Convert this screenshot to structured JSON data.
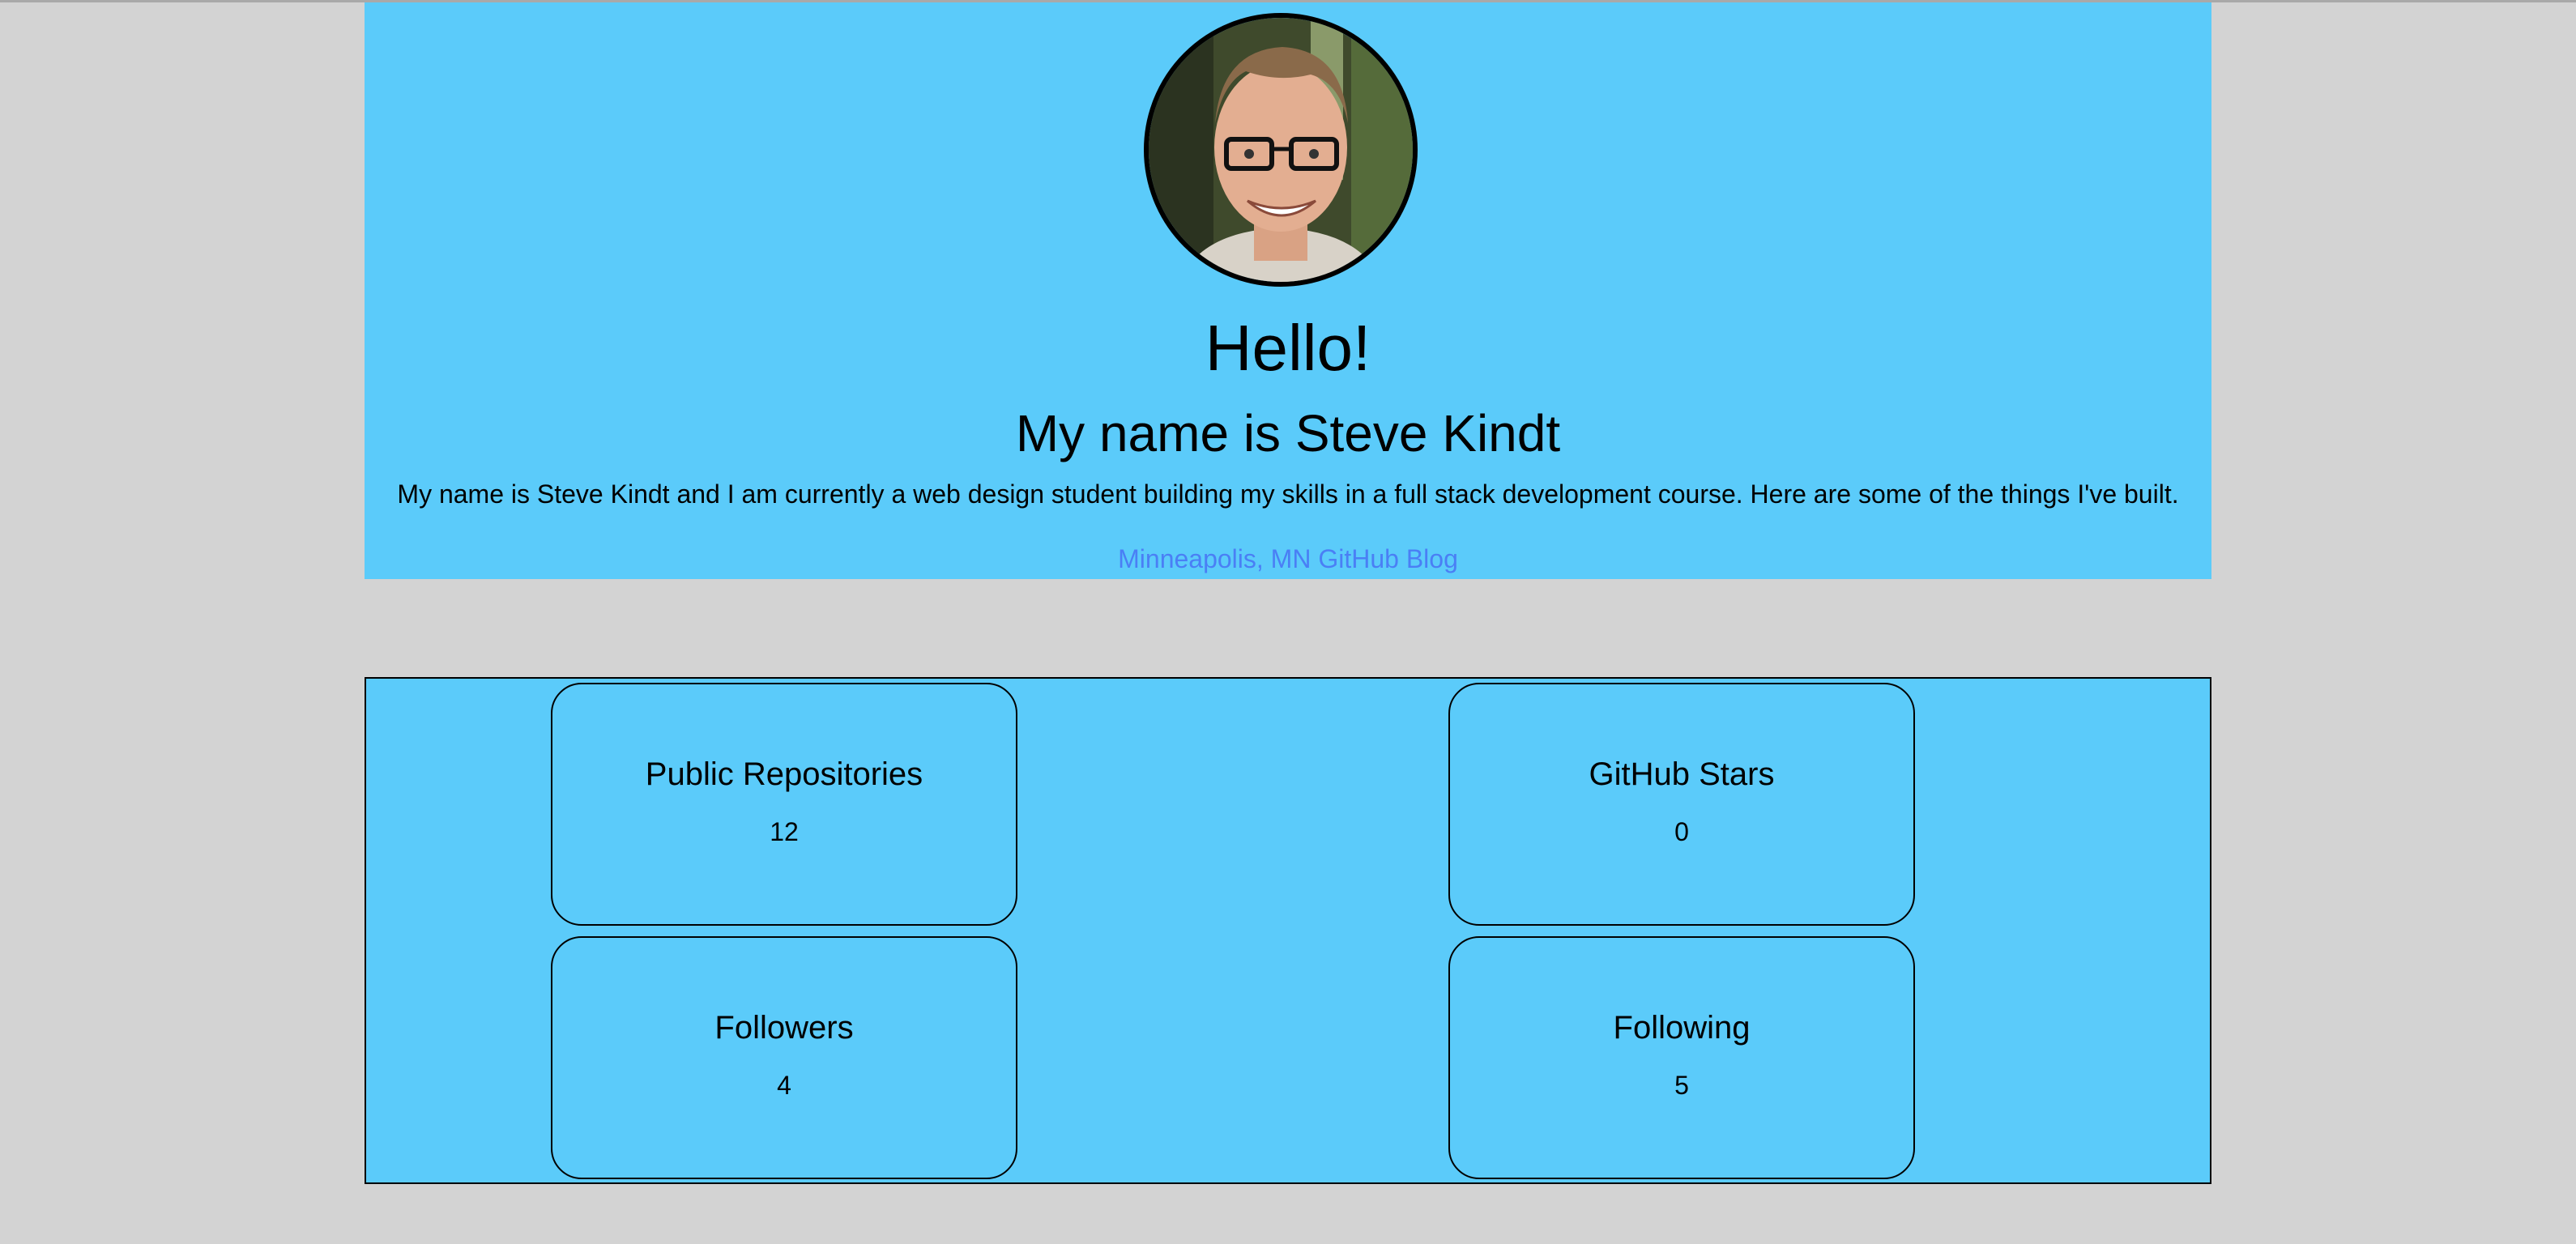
{
  "profile": {
    "greeting": "Hello!",
    "name_line": "My name is Steve Kindt",
    "bio": "My name is Steve Kindt and I am currently a web design student building my skills in a full stack development course. Here are some of the things I've built.",
    "links": {
      "location": "Minneapolis, MN",
      "github": "GitHub",
      "blog": "Blog"
    },
    "avatar_icon": "profile-photo"
  },
  "stats": {
    "public_repos": {
      "label": "Public Repositories",
      "value": "12"
    },
    "github_stars": {
      "label": "GitHub Stars",
      "value": "0"
    },
    "followers": {
      "label": "Followers",
      "value": "4"
    },
    "following": {
      "label": "Following",
      "value": "5"
    }
  },
  "colors": {
    "page_background": "#d3d3d3",
    "panel_background": "#5bcbfa",
    "link": "#4a7ff5"
  }
}
